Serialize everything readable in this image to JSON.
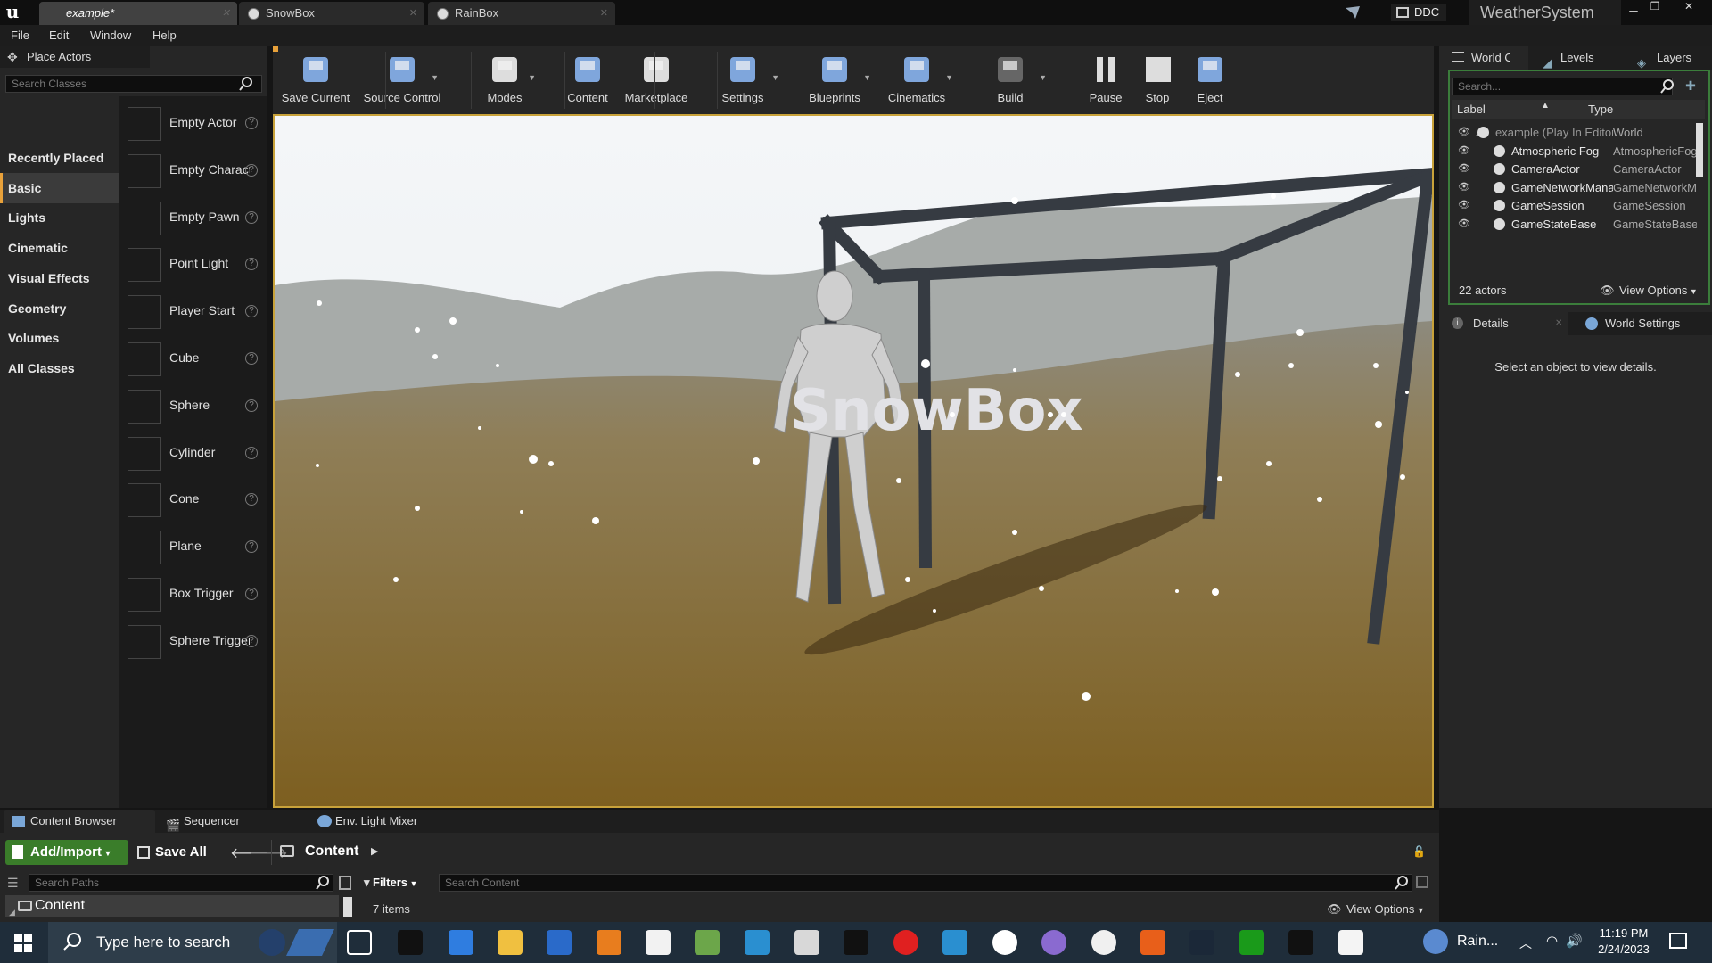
{
  "title_bar": {
    "tabs": [
      {
        "label": "example*",
        "active": true
      },
      {
        "label": "SnowBox",
        "active": false
      },
      {
        "label": "RainBox",
        "active": false
      }
    ],
    "ddc_label": "DDC",
    "project_name": "WeatherSystem"
  },
  "menu": {
    "items": [
      "File",
      "Edit",
      "Window",
      "Help"
    ]
  },
  "place_actors": {
    "tab_label": "Place Actors",
    "search_placeholder": "Search Classes",
    "categories": [
      "Recently Placed",
      "Basic",
      "Lights",
      "Cinematic",
      "Visual Effects",
      "Geometry",
      "Volumes",
      "All Classes"
    ],
    "active_category": "Basic",
    "actors": [
      "Empty Actor",
      "Empty Character",
      "Empty Pawn",
      "Point Light",
      "Player Start",
      "Cube",
      "Sphere",
      "Cylinder",
      "Cone",
      "Plane",
      "Box Trigger",
      "Sphere Trigger"
    ]
  },
  "toolbar": {
    "buttons": [
      "Save Current",
      "Source Control",
      "Modes",
      "Content",
      "Marketplace",
      "Settings",
      "Blueprints",
      "Cinematics",
      "Build",
      "Pause",
      "Stop",
      "Eject"
    ]
  },
  "viewport": {
    "scene_text": "SnowBox"
  },
  "world_outliner": {
    "tabs": [
      "World Outliner",
      "Levels",
      "Layers"
    ],
    "search_placeholder": "Search...",
    "col_label": "Label",
    "col_type": "Type",
    "rows": [
      {
        "label": "example (Play In Editor)",
        "type": "World"
      },
      {
        "label": "Atmospheric Fog",
        "type": "AtmosphericFog"
      },
      {
        "label": "CameraActor",
        "type": "CameraActor"
      },
      {
        "label": "GameNetworkManager",
        "type": "GameNetworkManager"
      },
      {
        "label": "GameSession",
        "type": "GameSession"
      },
      {
        "label": "GameStateBase",
        "type": "GameStateBase"
      }
    ],
    "actor_count": "22 actors",
    "view_options": "View Options"
  },
  "details": {
    "tabs": [
      "Details",
      "World Settings"
    ],
    "empty_text": "Select an object to view details."
  },
  "content_browser": {
    "tabs": [
      "Content Browser",
      "Sequencer",
      "Env. Light Mixer"
    ],
    "add_import": "Add/Import",
    "save_all": "Save All",
    "path": "Content",
    "search_paths_placeholder": "Search Paths",
    "folder": "Content",
    "filters": "Filters",
    "search_content_placeholder": "Search Content",
    "item_count": "7 items",
    "view_options": "View Options"
  },
  "taskbar": {
    "search_placeholder": "Type here to search",
    "weather": "Rain...",
    "time": "11:19 PM",
    "date": "2/24/2023"
  },
  "colors": {
    "accent": "#e8a13a",
    "outliner_border": "#3b7d3b",
    "taskbar": "#1f2d3a"
  }
}
